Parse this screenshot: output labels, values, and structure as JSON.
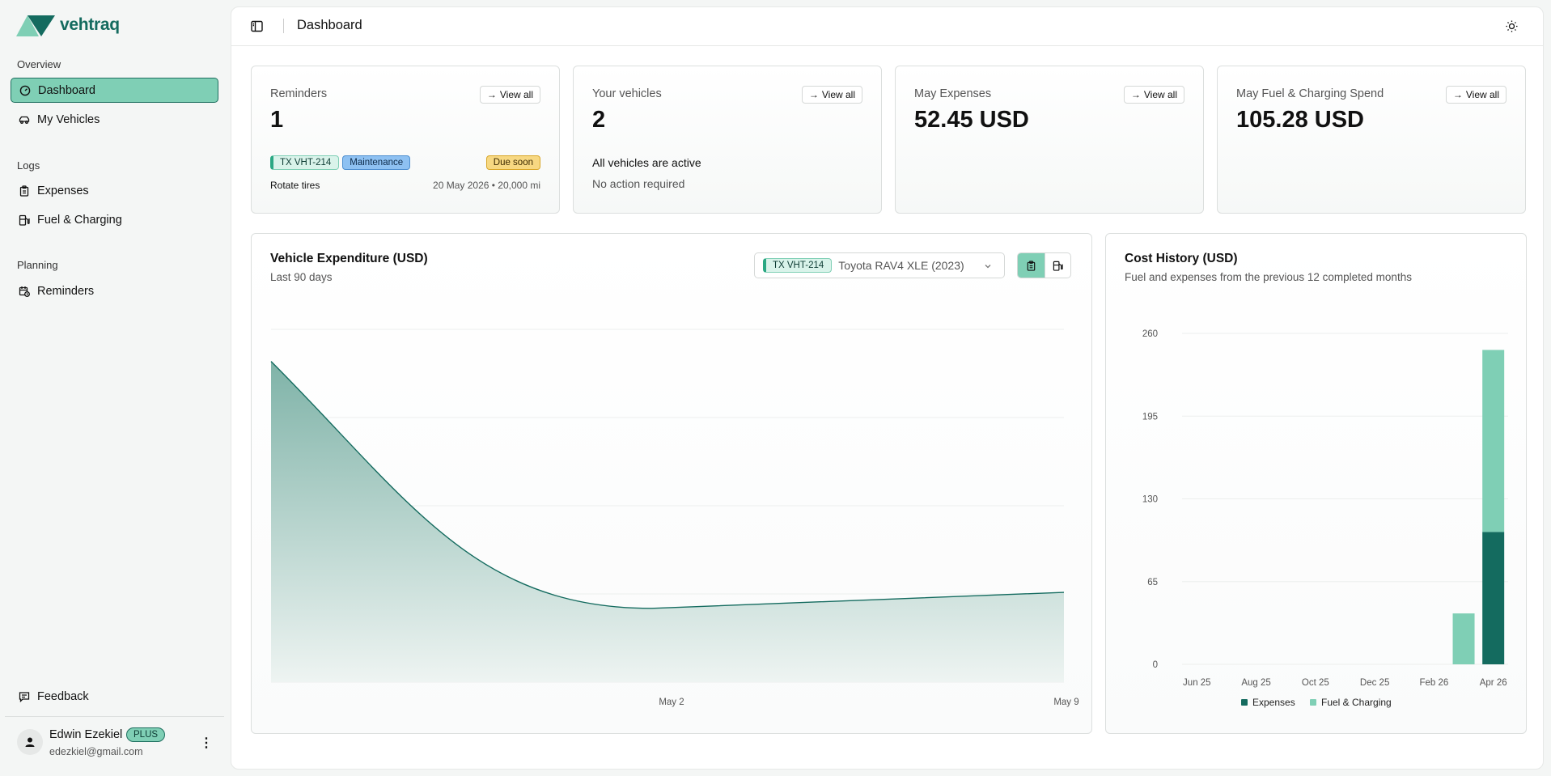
{
  "app": {
    "name": "vehtraq",
    "page_title": "Dashboard"
  },
  "sidebar": {
    "sections": [
      {
        "label": "Overview",
        "items": [
          {
            "label": "Dashboard",
            "icon": "gauge-icon",
            "active": true
          },
          {
            "label": "My Vehicles",
            "icon": "car-icon"
          }
        ]
      },
      {
        "label": "Logs",
        "items": [
          {
            "label": "Expenses",
            "icon": "clipboard-icon"
          },
          {
            "label": "Fuel & Charging",
            "icon": "fuel-icon"
          }
        ]
      },
      {
        "label": "Planning",
        "items": [
          {
            "label": "Reminders",
            "icon": "calendar-clock-icon"
          }
        ]
      }
    ],
    "feedback_label": "Feedback",
    "user": {
      "name": "Edwin Ezekiel",
      "plan": "PLUS",
      "email": "edezkiel@gmail.com"
    }
  },
  "cards": {
    "view_all_label": "View all",
    "reminders": {
      "label": "Reminders",
      "value": "1",
      "item": {
        "plate": "TX VHT-214",
        "category": "Maintenance",
        "status": "Due soon",
        "title": "Rotate tires",
        "meta": "20 May 2026 • 20,000 mi"
      }
    },
    "vehicles": {
      "label": "Your vehicles",
      "value": "2",
      "status": "All vehicles are active",
      "note": "No action required"
    },
    "expenses": {
      "label": "May Expenses",
      "value": "52.45 USD"
    },
    "fuel": {
      "label": "May Fuel & Charging Spend",
      "value": "105.28 USD"
    }
  },
  "vehicle_expenditure": {
    "title": "Vehicle Expenditure (USD)",
    "subtitle": "Last 90 days",
    "selector": {
      "plate": "TX VHT-214",
      "vehicle": "Toyota RAV4 XLE (2023)"
    },
    "colors": {
      "stroke": "#146b5f",
      "fill_top": "#7fb3a8",
      "fill_bottom": "#eef4f2"
    }
  },
  "cost_history": {
    "title": "Cost History (USD)",
    "subtitle": "Fuel and expenses from the previous 12 completed months",
    "colors": {
      "expenses": "#146b5f",
      "fuel": "#7fcfb5"
    }
  },
  "chart_data": [
    {
      "type": "area",
      "title": "Vehicle Expenditure (USD)",
      "x_tick_labels": [
        "May 2",
        "May 9"
      ],
      "x": [
        0,
        48,
        100
      ],
      "y": [
        100,
        23,
        28
      ],
      "ylim": [
        0,
        110
      ],
      "grid": true
    },
    {
      "type": "bar",
      "stacked": true,
      "title": "Cost History (USD)",
      "categories": [
        "Jun 25",
        "Jul 25",
        "Aug 25",
        "Sep 25",
        "Oct 25",
        "Nov 25",
        "Dec 25",
        "Jan 26",
        "Feb 26",
        "Mar 26",
        "Apr 26"
      ],
      "x_tick_labels": [
        "Jun 25",
        "Aug 25",
        "Oct 25",
        "Dec 25",
        "Feb 26",
        "Apr 26"
      ],
      "series": [
        {
          "name": "Expenses",
          "values": [
            0,
            0,
            0,
            0,
            0,
            0,
            0,
            0,
            0,
            0,
            104
          ]
        },
        {
          "name": "Fuel & Charging",
          "values": [
            0,
            0,
            0,
            0,
            0,
            0,
            0,
            0,
            0,
            40,
            143
          ]
        }
      ],
      "yticks": [
        0,
        65,
        130,
        195,
        260
      ],
      "ylim": [
        0,
        260
      ],
      "legend": "bottom",
      "grid": true
    }
  ]
}
